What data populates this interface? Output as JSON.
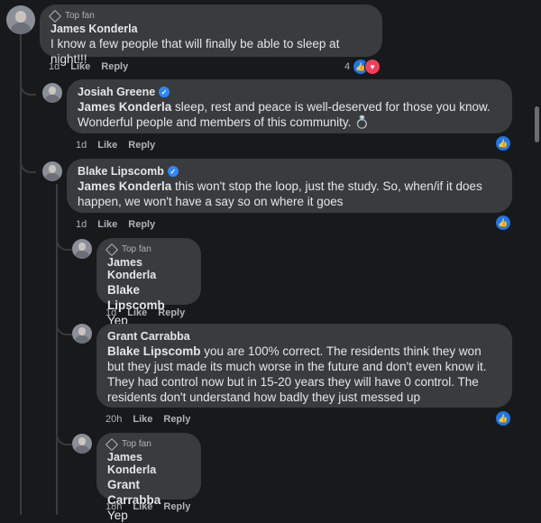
{
  "comments": [
    {
      "badge": "Top fan",
      "name": "James Konderla",
      "mention": "",
      "text": "I know a few people that will finally be able to sleep at night!!!",
      "time": "1d",
      "like": "Like",
      "reply": "Reply",
      "reaction_count": "4"
    },
    {
      "badge": "",
      "name": "Josiah Greene",
      "mention": "James Konderla",
      "text": " sleep, rest and peace is well-deserved for those you know. Wonderful people and members of this community. 💍",
      "time": "1d",
      "like": "Like",
      "reply": "Reply"
    },
    {
      "badge": "",
      "name": "Blake Lipscomb",
      "mention": "James Konderla",
      "text": " this won't stop the loop, just the study. So, when/if it does happen, we won't have a say so on where it goes",
      "time": "1d",
      "like": "Like",
      "reply": "Reply"
    },
    {
      "badge": "Top fan",
      "name": "James Konderla",
      "mention": "Blake Lipscomb",
      "text": "Yep",
      "time": "1d",
      "like": "Like",
      "reply": "Reply"
    },
    {
      "badge": "",
      "name": "Grant Carrabba",
      "mention": "Blake Lipscomb",
      "text": " you are 100% correct. The residents think they won but they just made its much worse in the future and don't even know it. They had control now but in 15-20 years they will have 0 control. The residents don't understand how badly they just messed up",
      "time": "20h",
      "like": "Like",
      "reply": "Reply"
    },
    {
      "badge": "Top fan",
      "name": "James Konderla",
      "mention": "Grant Carrabba",
      "text": "Yep",
      "time": "18h",
      "like": "Like",
      "reply": "Reply"
    }
  ],
  "icons": {
    "like": "thumbs-up-icon",
    "love": "heart-icon",
    "verified": "verified-badge-icon",
    "top_fan": "diamond-icon"
  },
  "colors": {
    "background": "#18191a",
    "bubble": "#3a3b3c",
    "like_blue": "#1877f2",
    "love_red": "#f33e58",
    "verified_blue": "#2d88ff"
  }
}
